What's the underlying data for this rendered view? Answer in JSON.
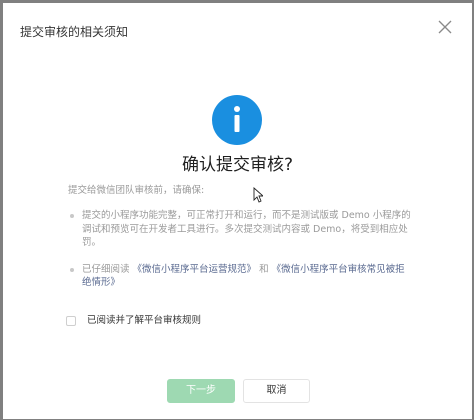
{
  "dialog": {
    "title": "提交审核的相关须知",
    "close_icon": "close-icon"
  },
  "info_icon": {
    "name": "info-icon",
    "color": "#1a8fe0"
  },
  "confirm_title": "确认提交审核?",
  "intro": "提交给微信团队审核前，请确保:",
  "checklist": {
    "item1": "提交的小程序功能完整，可正常打开和运行，而不是测试版或 Demo 小程序的调试和预览可在开发者工具进行。多次提交测试内容或 Demo，将受到相应处罚。",
    "item2_prefix": "已仔细阅读",
    "item2_link1": "《微信小程序平台运营规范》",
    "item2_and": "和",
    "item2_link2": "《微信小程序平台审核常见被拒绝情形》"
  },
  "agree": {
    "label": "已阅读并了解平台审核规则",
    "checked": false
  },
  "buttons": {
    "next_label": "下一步",
    "cancel_label": "取消"
  },
  "colors": {
    "primary_disabled": "#9ed9b2",
    "link": "#5b6b91",
    "info": "#1a8fe0"
  }
}
